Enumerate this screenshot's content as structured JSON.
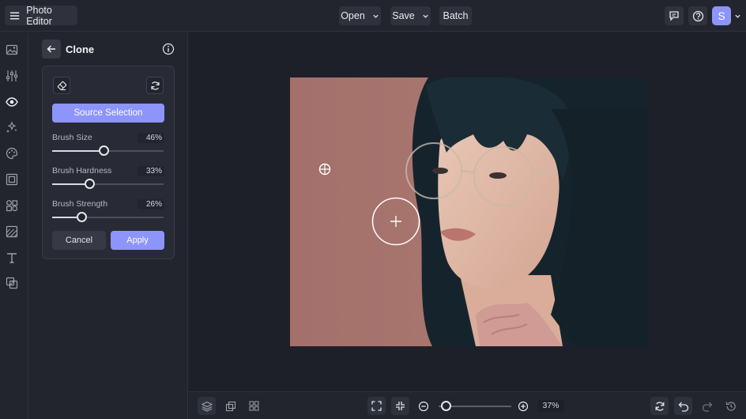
{
  "app": {
    "title": "Photo Editor"
  },
  "toolbar": {
    "open_label": "Open",
    "save_label": "Save",
    "batch_label": "Batch",
    "avatar_letter": "S"
  },
  "rail": {
    "icons": [
      "image-icon",
      "adjust-icon",
      "eye-icon",
      "effects-icon",
      "palette-icon",
      "frame-icon",
      "graphics-icon",
      "texture-icon",
      "text-icon",
      "overlay-icon"
    ]
  },
  "panel": {
    "title": "Clone",
    "source_button": "Source Selection",
    "sliders": [
      {
        "label": "Brush Size",
        "value": 46,
        "display": "46%"
      },
      {
        "label": "Brush Hardness",
        "value": 33,
        "display": "33%"
      },
      {
        "label": "Brush Strength",
        "value": 26,
        "display": "26%"
      }
    ],
    "cancel_label": "Cancel",
    "apply_label": "Apply"
  },
  "bottombar": {
    "zoom_display": "37%",
    "zoom_value": 37
  },
  "colors": {
    "accent": "#8d95fb",
    "background": "#1f222b",
    "panel": "#22252e",
    "photo_backdrop": "#a8716c"
  }
}
